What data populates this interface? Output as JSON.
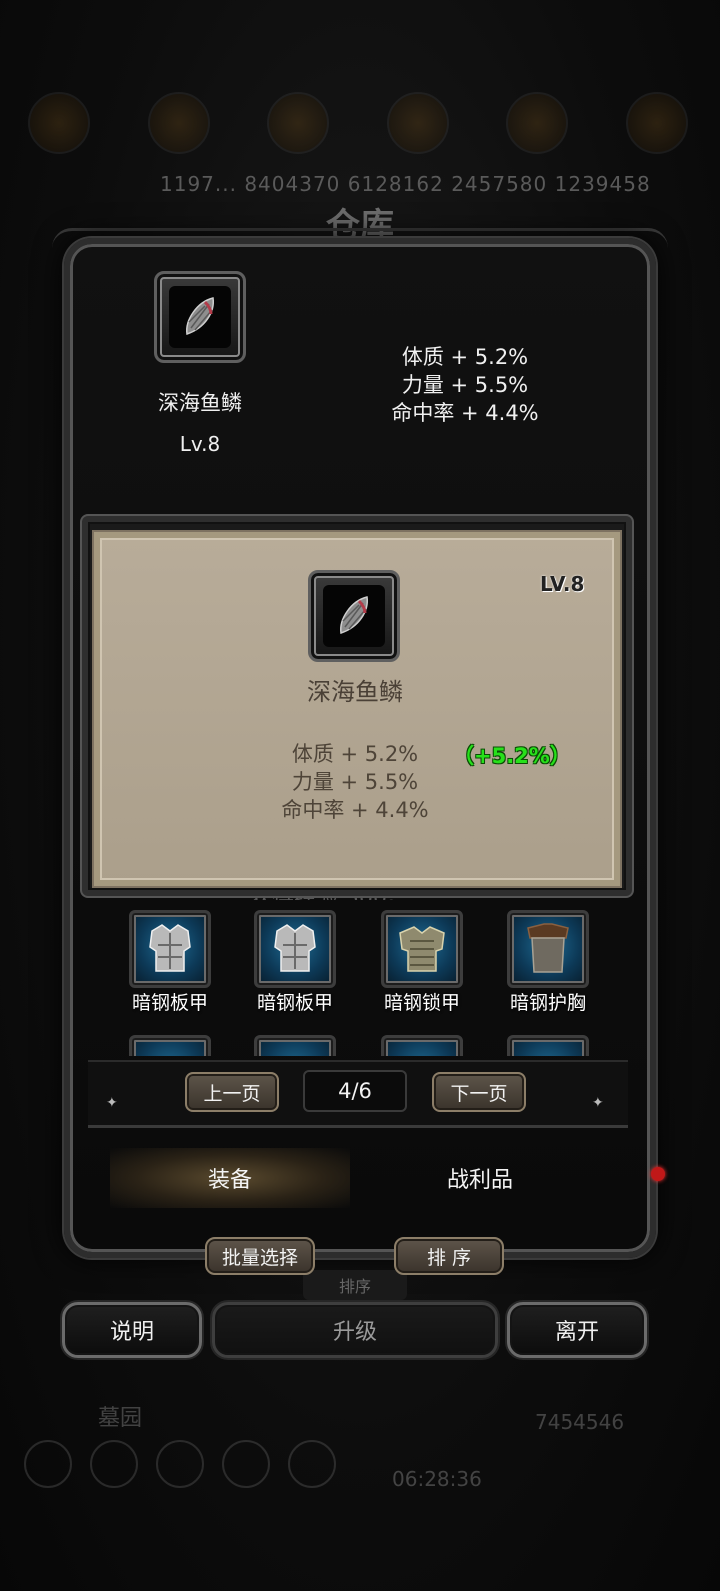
{
  "background": {
    "stats_line": "1197... 8404370 6128162 2457580 1239458",
    "title": "仓库",
    "section": "墓园",
    "gold": "7454546",
    "timer": "06:28:36"
  },
  "selected_item": {
    "name": "深海鱼鳞",
    "level": "Lv.8",
    "stats": [
      "体质 + 5.2%",
      "力量 + 5.5%",
      "命中率 + 4.4%"
    ],
    "icon": "fish-scale-icon"
  },
  "tooltip": {
    "level": "LV.8",
    "name": "深海鱼鳞",
    "stats": [
      "体质 + 5.2%",
      "力量 + 5.5%",
      "命中率 + 4.4%"
    ],
    "bonus": "（+5.2%）",
    "bonus_color": "#27e11a"
  },
  "behind_text": "获得经验 500。",
  "items": [
    {
      "label": "暗钢板甲",
      "icon": "plate-armor-icon"
    },
    {
      "label": "暗钢板甲",
      "icon": "plate-armor-icon"
    },
    {
      "label": "暗钢锁甲",
      "icon": "chain-mail-icon"
    },
    {
      "label": "暗钢护胸",
      "icon": "breastplate-icon"
    }
  ],
  "pager": {
    "prev": "上一页",
    "page": "4/6",
    "next": "下一页"
  },
  "tabs": {
    "equip": "装备",
    "loot": "战利品"
  },
  "actions": {
    "batch": "批量选择",
    "sort": "排 序",
    "sort_ghost": "排序"
  },
  "bottom": {
    "help": "说明",
    "upgrade": "升级",
    "leave": "离开"
  }
}
